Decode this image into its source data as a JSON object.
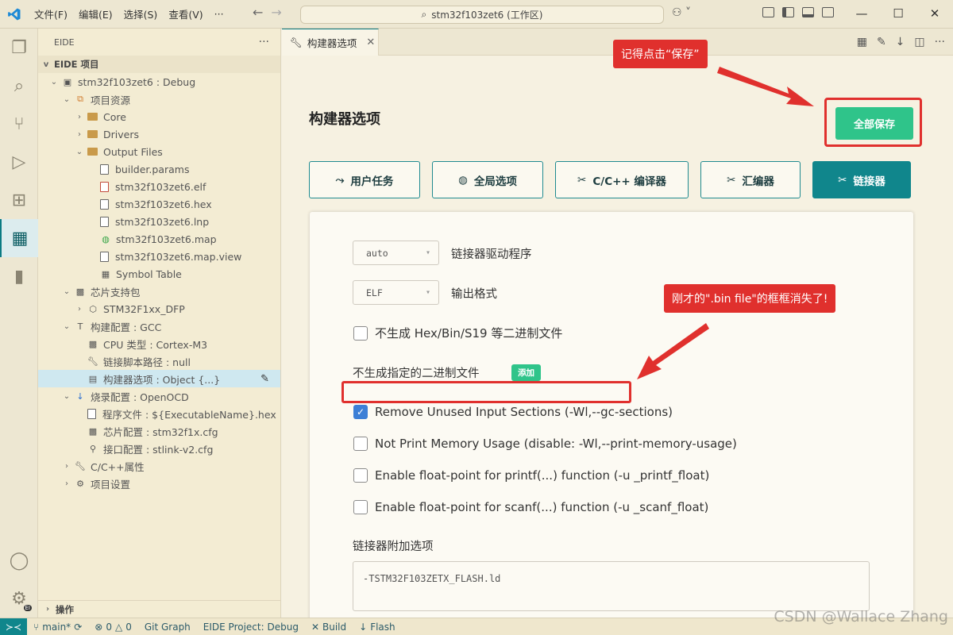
{
  "titlebar": {
    "menu": [
      "文件(F)",
      "编辑(E)",
      "选择(S)",
      "查看(V)",
      "···"
    ],
    "search_text": "stm32f103zet6 (工作区)"
  },
  "sidebar": {
    "header": "EIDE",
    "section_title": "EIDE 项目",
    "footer_label": "操作",
    "tree": [
      {
        "label": "stm32f103zet6 : Debug",
        "indent": 0,
        "chev": "v",
        "icon": "project-icon"
      },
      {
        "label": "项目资源",
        "indent": 1,
        "chev": "v",
        "icon": "resources-icon"
      },
      {
        "label": "Core",
        "indent": 2,
        "chev": ">",
        "icon": "folder-icon"
      },
      {
        "label": "Drivers",
        "indent": 2,
        "chev": ">",
        "icon": "folder-icon"
      },
      {
        "label": "Output Files",
        "indent": 2,
        "chev": "v",
        "icon": "folder-icon"
      },
      {
        "label": "builder.params",
        "indent": 3,
        "chev": "",
        "icon": "file-icon"
      },
      {
        "label": "stm32f103zet6.elf",
        "indent": 3,
        "chev": "",
        "icon": "file-red-icon"
      },
      {
        "label": "stm32f103zet6.hex",
        "indent": 3,
        "chev": "",
        "icon": "file-icon"
      },
      {
        "label": "stm32f103zet6.lnp",
        "indent": 3,
        "chev": "",
        "icon": "file-icon"
      },
      {
        "label": "stm32f103zet6.map",
        "indent": 3,
        "chev": "",
        "icon": "globe-icon"
      },
      {
        "label": "stm32f103zet6.map.view",
        "indent": 3,
        "chev": "",
        "icon": "file-icon"
      },
      {
        "label": "Symbol Table",
        "indent": 3,
        "chev": "",
        "icon": "table-icon"
      },
      {
        "label": "芯片支持包",
        "indent": 1,
        "chev": "v",
        "icon": "chip-icon"
      },
      {
        "label": "STM32F1xx_DFP",
        "indent": 2,
        "chev": ">",
        "icon": "package-icon"
      },
      {
        "label": "构建配置 : GCC",
        "indent": 1,
        "chev": "v",
        "icon": "hammer-icon"
      },
      {
        "label": "CPU 类型 : Cortex-M3",
        "indent": 2,
        "chev": "",
        "icon": "chip-icon"
      },
      {
        "label": "链接脚本路径 : null",
        "indent": 2,
        "chev": "",
        "icon": "wrench-icon"
      },
      {
        "label": "构建器选项 : Object {...}",
        "indent": 2,
        "chev": "",
        "icon": "options-icon",
        "selected": true
      },
      {
        "label": "烧录配置 : OpenOCD",
        "indent": 1,
        "chev": "v",
        "icon": "download-icon"
      },
      {
        "label": "程序文件 : ${ExecutableName}.hex",
        "indent": 2,
        "chev": "",
        "icon": "file-icon"
      },
      {
        "label": "芯片配置 : stm32f1x.cfg",
        "indent": 2,
        "chev": "",
        "icon": "chip-icon"
      },
      {
        "label": "接口配置 : stlink-v2.cfg",
        "indent": 2,
        "chev": "",
        "icon": "plug-icon"
      },
      {
        "label": "C/C++属性",
        "indent": 1,
        "chev": ">",
        "icon": "wrench-icon"
      },
      {
        "label": "项目设置",
        "indent": 1,
        "chev": ">",
        "icon": "gear-icon"
      }
    ]
  },
  "tab": {
    "label": "构建器选项"
  },
  "editor": {
    "title": "构建器选项",
    "save_all": "全部保存",
    "option_tabs": [
      {
        "label": "用户任务",
        "icon": "run-icon",
        "active": false
      },
      {
        "label": "全局选项",
        "icon": "globe-icon",
        "active": false
      },
      {
        "label": "C/C++ 编译器",
        "icon": "tools-icon",
        "active": false
      },
      {
        "label": "汇编器",
        "icon": "tools-icon",
        "active": false
      },
      {
        "label": "链接器",
        "icon": "tools-icon",
        "active": true
      }
    ],
    "linker_driver": {
      "value": "auto",
      "label": "链接器驱动程序"
    },
    "output_format": {
      "value": "ELF",
      "label": "输出格式"
    },
    "checkboxes": [
      {
        "label": "不生成 Hex/Bin/S19 等二进制文件",
        "checked": false
      },
      {
        "label": "Remove Unused Input Sections (-Wl,--gc-sections)",
        "checked": true
      },
      {
        "label": "Not Print Memory Usage (disable: -Wl,--print-memory-usage)",
        "checked": false
      },
      {
        "label": "Enable float-point for printf(...) function (-u _printf_float)",
        "checked": false
      },
      {
        "label": "Enable float-point for scanf(...) function (-u _scanf_float)",
        "checked": false
      }
    ],
    "no_bin_label": "不生成指定的二进制文件",
    "add_label": "添加",
    "extra_options_label": "链接器附加选项",
    "extra_options_value": "-TSTM32F103ZETX_FLASH.ld"
  },
  "annotations": {
    "save_note": "记得点击“保存”",
    "missing_note": "刚才的\".bin file\"的框框消失了!"
  },
  "statusbar": {
    "branch": "main*",
    "problems": "0",
    "warnings": "0",
    "git_graph": "Git Graph",
    "project": "EIDE Project: Debug",
    "build": "Build",
    "flash": "Flash"
  },
  "watermark": "CSDN @Wallace Zhang",
  "colors": {
    "accent": "#10868c",
    "save_green": "#2fc48a",
    "annotation_red": "#e0302d"
  }
}
